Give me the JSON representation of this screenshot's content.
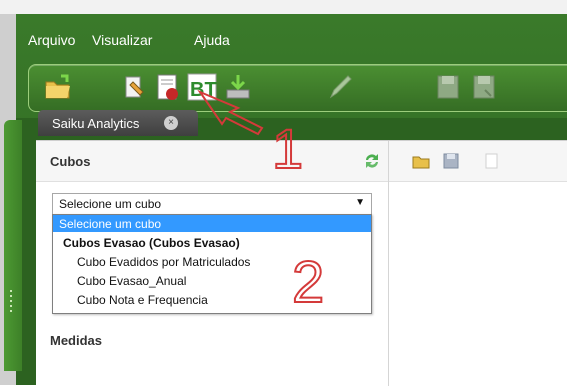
{
  "menu": {
    "items": [
      "Arquivo",
      "Visualizar",
      "Ajuda"
    ]
  },
  "toolbar": {
    "buttons": [
      "open-folder-icon",
      "edit-query-icon",
      "report-icon",
      "bt-icon",
      "download-icon",
      "pencil-icon",
      "save-icon",
      "save-as-icon"
    ]
  },
  "tab": {
    "label": "Saiku Analytics",
    "close": "×"
  },
  "cubes": {
    "title": "Cubos",
    "select_value": "Selecione um cubo",
    "arrow": "▼",
    "options": [
      {
        "label": "Selecione um cubo",
        "type": "selected"
      },
      {
        "label": "Cubos Evasao (Cubos Evasao)",
        "type": "group"
      },
      {
        "label": "Cubo Evadidos por Matriculados",
        "type": "item"
      },
      {
        "label": "Cubo Evasao_Anual",
        "type": "item"
      },
      {
        "label": "Cubo Nota e Frequencia",
        "type": "item"
      }
    ]
  },
  "measures": {
    "title": "Medidas"
  },
  "annotations": {
    "one": "1",
    "two": "2"
  },
  "colors": {
    "app_green": "#2c6220",
    "select_blue": "#3399ff",
    "annotation_red": "#d43a3a"
  }
}
